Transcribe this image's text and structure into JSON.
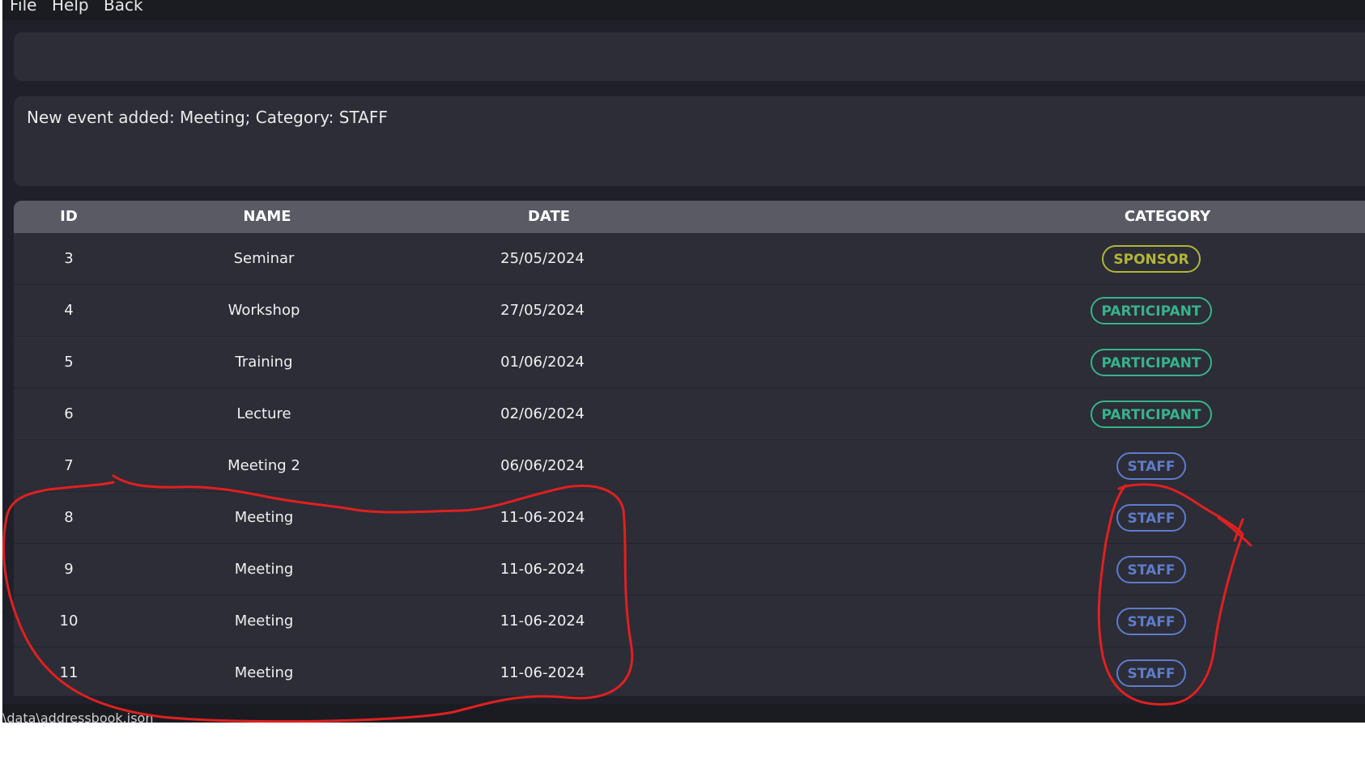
{
  "menu": {
    "file": "File",
    "help": "Help",
    "back": "Back"
  },
  "command": {
    "value": ""
  },
  "result": {
    "message": "New event added: Meeting; Category: STAFF"
  },
  "table": {
    "headers": {
      "id": "ID",
      "name": "NAME",
      "date": "DATE",
      "category": "CATEGORY"
    },
    "rows": [
      {
        "id": "3",
        "name": "Seminar",
        "date": "25/05/2024",
        "category": "SPONSOR"
      },
      {
        "id": "4",
        "name": "Workshop",
        "date": "27/05/2024",
        "category": "PARTICIPANT"
      },
      {
        "id": "5",
        "name": "Training",
        "date": "01/06/2024",
        "category": "PARTICIPANT"
      },
      {
        "id": "6",
        "name": "Lecture",
        "date": "02/06/2024",
        "category": "PARTICIPANT"
      },
      {
        "id": "7",
        "name": "Meeting 2",
        "date": "06/06/2024",
        "category": "STAFF"
      },
      {
        "id": "8",
        "name": "Meeting",
        "date": "11-06-2024",
        "category": "STAFF"
      },
      {
        "id": "9",
        "name": "Meeting",
        "date": "11-06-2024",
        "category": "STAFF"
      },
      {
        "id": "10",
        "name": "Meeting",
        "date": "11-06-2024",
        "category": "STAFF"
      },
      {
        "id": "11",
        "name": "Meeting",
        "date": "11-06-2024",
        "category": "STAFF"
      }
    ]
  },
  "status": {
    "path": "\\data\\addressbook.json"
  },
  "colors": {
    "sponsor": "#b3b537",
    "participant": "#36b38b",
    "staff": "#5e7cc9",
    "annotation": "#e02020"
  }
}
